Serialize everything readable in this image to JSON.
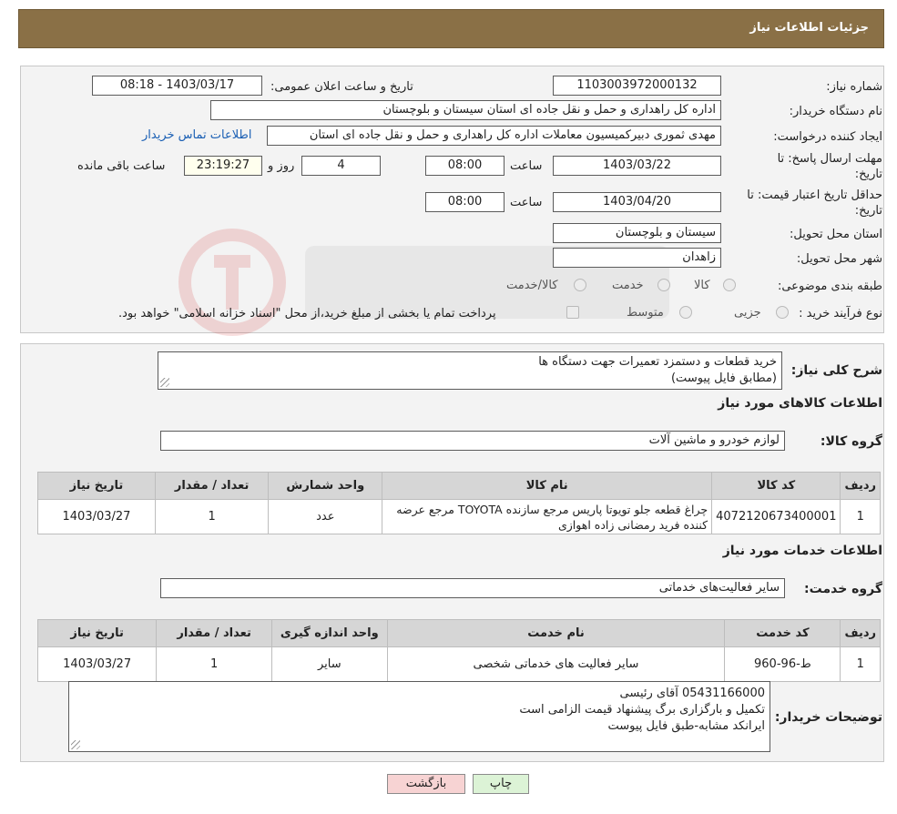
{
  "header": {
    "title": "جزئیات اطلاعات نیاز"
  },
  "form": {
    "need_number_label": "شماره نیاز:",
    "need_number": "1103003972000132",
    "announce_label": "تاریخ و ساعت اعلان عمومی:",
    "announce_value": "1403/03/17 - 08:18",
    "buyer_org_label": "نام دستگاه خریدار:",
    "buyer_org": "اداره کل راهداری و حمل و نقل جاده ای استان سیستان و بلوچستان",
    "requester_label": "ایجاد کننده درخواست:",
    "requester": "مهدی ثموری دبیرکمیسیون معاملات اداره کل راهداری و حمل و نقل جاده ای استان",
    "contact_link": "اطلاعات تماس خریدار",
    "reply_deadline_label_1": "مهلت ارسال پاسخ: تا",
    "reply_deadline_label_2": "تاریخ:",
    "reply_date": "1403/03/22",
    "time_label": "ساعت",
    "reply_time": "08:00",
    "days_value": "4",
    "days_label": "روز و",
    "remaining_time": "23:19:27",
    "remaining_label": "ساعت باقی مانده",
    "price_validity_label_1": "حداقل تاریخ اعتبار قیمت: تا",
    "price_validity_label_2": "تاریخ:",
    "price_date": "1403/04/20",
    "price_time": "08:00",
    "province_label": "استان محل تحویل:",
    "province": "سیستان و بلوچستان",
    "city_label": "شهر محل تحویل:",
    "city": "زاهدان",
    "category_label": "طبقه بندی موضوعی:",
    "category_options": [
      "کالا",
      "خدمت",
      "کالا/خدمت"
    ],
    "process_label": "نوع فرآیند خرید :",
    "process_options": [
      "جزیی",
      "متوسط"
    ],
    "process_note": "پرداخت تمام یا بخشی از مبلغ خرید،از محل \"اسناد خزانه اسلامی\" خواهد بود."
  },
  "description": {
    "label": "شرح کلی نیاز:",
    "line1": "خرید قطعات و دستمزد تعمیرات جهت دستگاه ها",
    "line2": "(مطابق فایل پیوست)"
  },
  "goods": {
    "section_title": "اطلاعات کالاهای مورد نیاز",
    "group_label": "گروه کالا:",
    "group_value": "لوازم خودرو و ماشین آلات",
    "headers": [
      "ردیف",
      "کد کالا",
      "نام کالا",
      "واحد شمارش",
      "تعداد / مقدار",
      "تاریخ نیاز"
    ],
    "rows": [
      {
        "index": "1",
        "code": "4072120673400001",
        "name_line1": "چراغ قطعه جلو تویوتا پاریس مرجع سازنده TOYOTA مرجع عرضه",
        "name_line2": "کننده فرید رمضانی زاده اهوازی",
        "unit": "عدد",
        "qty": "1",
        "date": "1403/03/27"
      }
    ]
  },
  "services": {
    "section_title": "اطلاعات خدمات مورد نیاز",
    "group_label": "گروه خدمت:",
    "group_value": "سایر فعالیت‌های خدماتی",
    "headers": [
      "ردیف",
      "کد خدمت",
      "نام خدمت",
      "واحد اندازه گیری",
      "تعداد / مقدار",
      "تاریخ نیاز"
    ],
    "rows": [
      {
        "index": "1",
        "code": "ط-96-960",
        "name": "سایر فعالیت های خدماتی شخصی",
        "unit": "سایر",
        "qty": "1",
        "date": "1403/03/27"
      }
    ]
  },
  "buyer_notes": {
    "label": "توضیحات خریدار:",
    "line1": "05431166000 آقای رئیسی",
    "line2": "تکمیل و بارگزاری برگ پیشنهاد قیمت الزامی است",
    "line3": "ایرانکد مشابه-طبق فایل پیوست"
  },
  "buttons": {
    "print": "چاپ",
    "back": "بازگشت"
  },
  "colors": {
    "header_bg": "#8a7046",
    "back_button_bg": "#f7d3d3",
    "print_button_bg": "#dcf3d6"
  }
}
